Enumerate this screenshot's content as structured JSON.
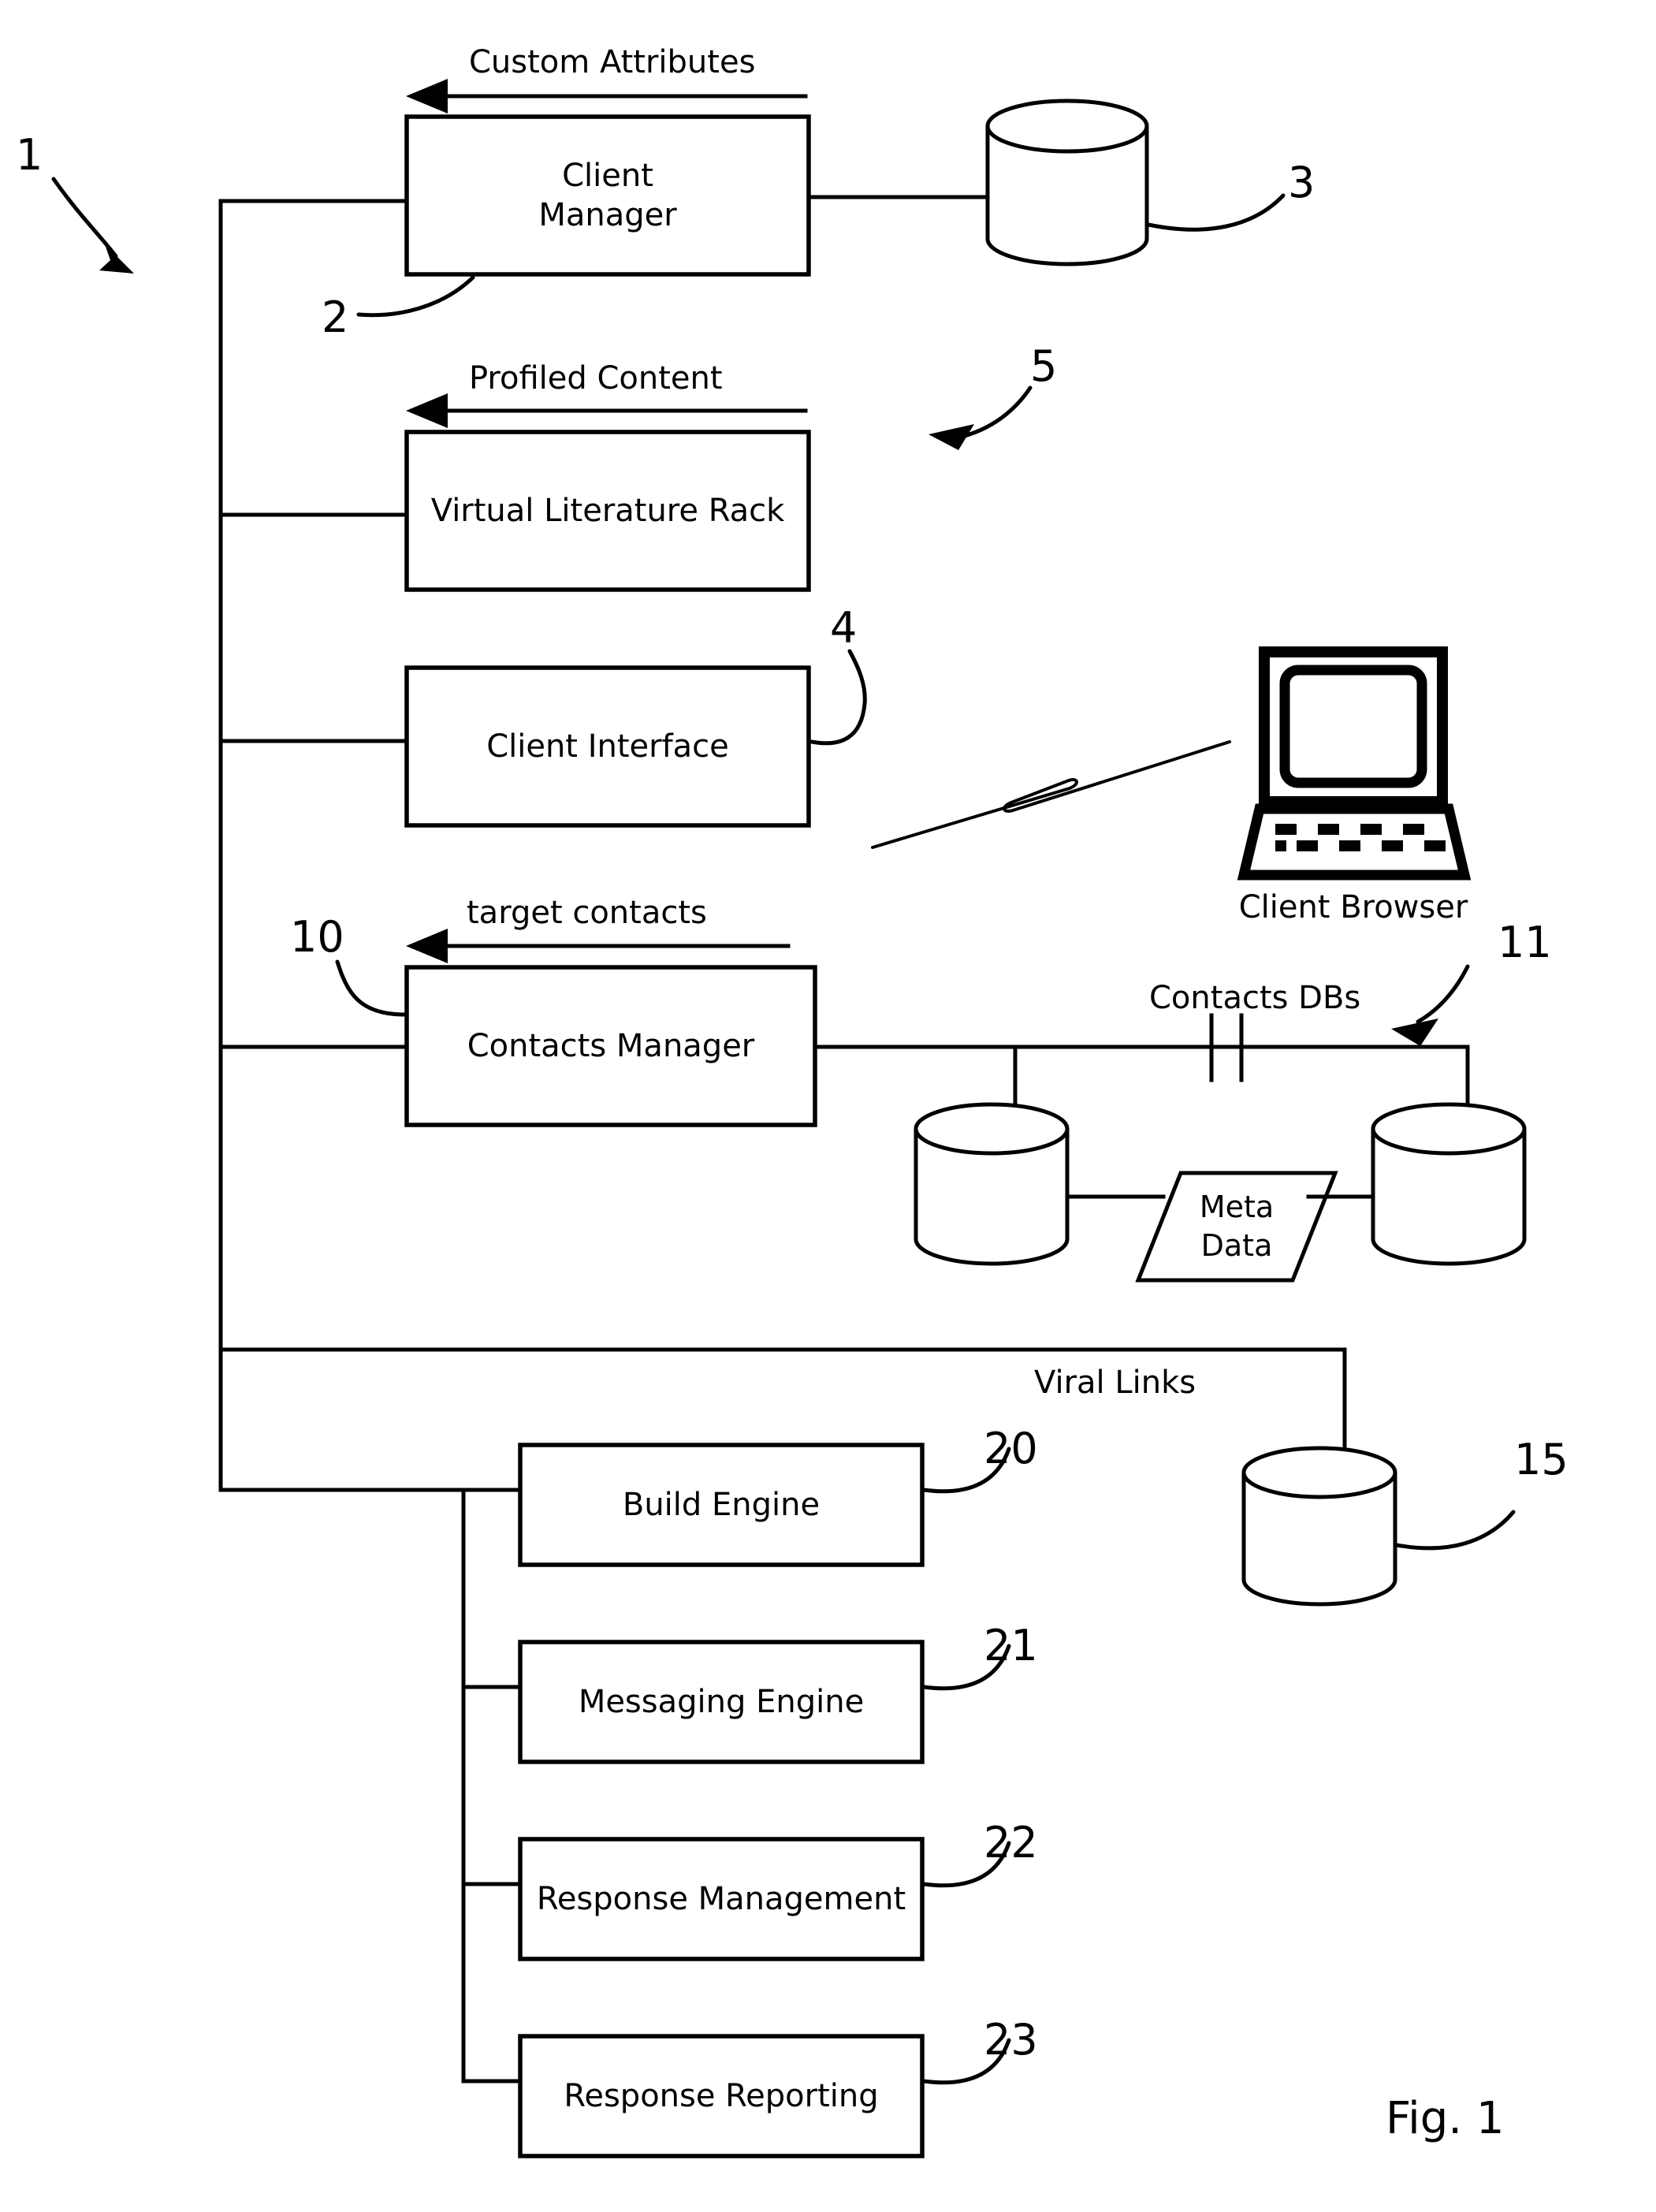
{
  "figure": {
    "caption": "Fig. 1",
    "system_reference": "1"
  },
  "flow_labels": [
    {
      "text": "Custom Attributes",
      "ref": "flow-custom-attributes"
    },
    {
      "text": "Profiled Content",
      "ref": "flow-profiled-content"
    },
    {
      "text": "target contacts",
      "ref": "flow-target-contacts"
    },
    {
      "text": "Viral Links",
      "ref": "flow-viral-links"
    }
  ],
  "blocks": [
    {
      "label_line1": "Client",
      "label_line2": "Manager",
      "ref": "2"
    },
    {
      "label_line1": "Virtual Literature Rack",
      "label_line2": "",
      "ref": "5"
    },
    {
      "label_line1": "Client Interface",
      "label_line2": "",
      "ref": "4"
    },
    {
      "label_line1": "Contacts Manager",
      "label_line2": "",
      "ref": "10"
    },
    {
      "label_line1": "Build Engine",
      "label_line2": "",
      "ref": "20"
    },
    {
      "label_line1": "Messaging Engine",
      "label_line2": "",
      "ref": "21"
    },
    {
      "label_line1": "Response Management",
      "label_line2": "",
      "ref": "22"
    },
    {
      "label_line1": "Response Reporting",
      "label_line2": "",
      "ref": "23"
    }
  ],
  "databases": [
    {
      "name": "client-database",
      "ref": "3"
    },
    {
      "name": "contacts-db-left",
      "ref": ""
    },
    {
      "name": "contacts-db-right",
      "ref": ""
    },
    {
      "name": "viral-links-database",
      "ref": "15"
    }
  ],
  "annotations": {
    "contacts_dbs_label": "Contacts DBs",
    "contacts_dbs_ref": "11",
    "meta_data_line1": "Meta",
    "meta_data_line2": "Data",
    "client_browser_label": "Client Browser"
  },
  "reference_numerals": {
    "system": "1",
    "client_manager": "2",
    "client_database": "3",
    "client_interface": "4",
    "virtual_literature_rack": "5",
    "contacts_manager": "10",
    "contacts_dbs": "11",
    "viral_links_db": "15",
    "build_engine": "20",
    "messaging_engine": "21",
    "response_management": "22",
    "response_reporting": "23"
  },
  "colors": {
    "ink": "#000000",
    "paper": "#ffffff"
  }
}
